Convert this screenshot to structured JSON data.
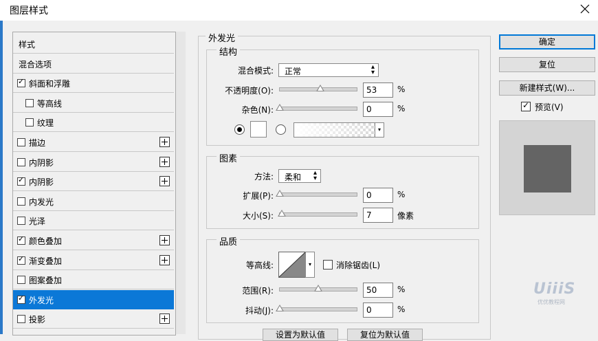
{
  "window": {
    "title": "图层样式"
  },
  "sidebar": {
    "items": [
      {
        "label": "样式",
        "checkbox": false,
        "checked": false,
        "plus": false,
        "indent": 0,
        "selected": false
      },
      {
        "label": "混合选项",
        "checkbox": false,
        "checked": false,
        "plus": false,
        "indent": 0,
        "selected": false
      },
      {
        "label": "斜面和浮雕",
        "checkbox": true,
        "checked": true,
        "plus": false,
        "indent": 0,
        "selected": false
      },
      {
        "label": "等高线",
        "checkbox": true,
        "checked": false,
        "plus": false,
        "indent": 1,
        "selected": false
      },
      {
        "label": "纹理",
        "checkbox": true,
        "checked": false,
        "plus": false,
        "indent": 1,
        "selected": false
      },
      {
        "label": "描边",
        "checkbox": true,
        "checked": false,
        "plus": true,
        "indent": 0,
        "selected": false
      },
      {
        "label": "内阴影",
        "checkbox": true,
        "checked": false,
        "plus": true,
        "indent": 0,
        "selected": false
      },
      {
        "label": "内阴影",
        "checkbox": true,
        "checked": true,
        "plus": true,
        "indent": 0,
        "selected": false
      },
      {
        "label": "内发光",
        "checkbox": true,
        "checked": false,
        "plus": false,
        "indent": 0,
        "selected": false
      },
      {
        "label": "光泽",
        "checkbox": true,
        "checked": false,
        "plus": false,
        "indent": 0,
        "selected": false
      },
      {
        "label": "颜色叠加",
        "checkbox": true,
        "checked": true,
        "plus": true,
        "indent": 0,
        "selected": false
      },
      {
        "label": "渐变叠加",
        "checkbox": true,
        "checked": true,
        "plus": true,
        "indent": 0,
        "selected": false
      },
      {
        "label": "图案叠加",
        "checkbox": true,
        "checked": false,
        "plus": false,
        "indent": 0,
        "selected": false
      },
      {
        "label": "外发光",
        "checkbox": true,
        "checked": true,
        "plus": false,
        "indent": 0,
        "selected": true
      },
      {
        "label": "投影",
        "checkbox": true,
        "checked": false,
        "plus": true,
        "indent": 0,
        "selected": false
      }
    ]
  },
  "panel": {
    "title": "外发光",
    "structure": {
      "title": "结构",
      "blend_mode_label": "混合模式:",
      "blend_mode_value": "正常",
      "opacity_label": "不透明度(O):",
      "opacity_value": "53",
      "opacity_fraction": 0.53,
      "opacity_unit": "%",
      "noise_label": "杂色(N):",
      "noise_value": "0",
      "noise_fraction": 0,
      "noise_unit": "%",
      "color_mode": "solid"
    },
    "elements": {
      "title": "图素",
      "technique_label": "方法:",
      "technique_value": "柔和",
      "spread_label": "扩展(P):",
      "spread_value": "0",
      "spread_fraction": 0,
      "spread_unit": "%",
      "size_label": "大小(S):",
      "size_value": "7",
      "size_fraction": 0.03,
      "size_unit": "像素"
    },
    "quality": {
      "title": "品质",
      "contour_label": "等高线:",
      "antialias_label": "消除锯齿(L)",
      "antialias_checked": false,
      "range_label": "范围(R):",
      "range_value": "50",
      "range_fraction": 0.5,
      "range_unit": "%",
      "jitter_label": "抖动(J):",
      "jitter_value": "0",
      "jitter_fraction": 0,
      "jitter_unit": "%"
    },
    "footer": {
      "set_default_label": "设置为默认值",
      "reset_default_label": "复位为默认值"
    }
  },
  "buttons": {
    "ok_label": "确定",
    "reset_label": "复位",
    "new_style_label": "新建样式(W)...",
    "preview_label": "预览(V)",
    "preview_checked": true
  },
  "watermark": {
    "text": "UiiiS",
    "sub": "优优教程网"
  },
  "colors": {
    "accent": "#0b78d7",
    "preview_swatch": "#646464"
  }
}
